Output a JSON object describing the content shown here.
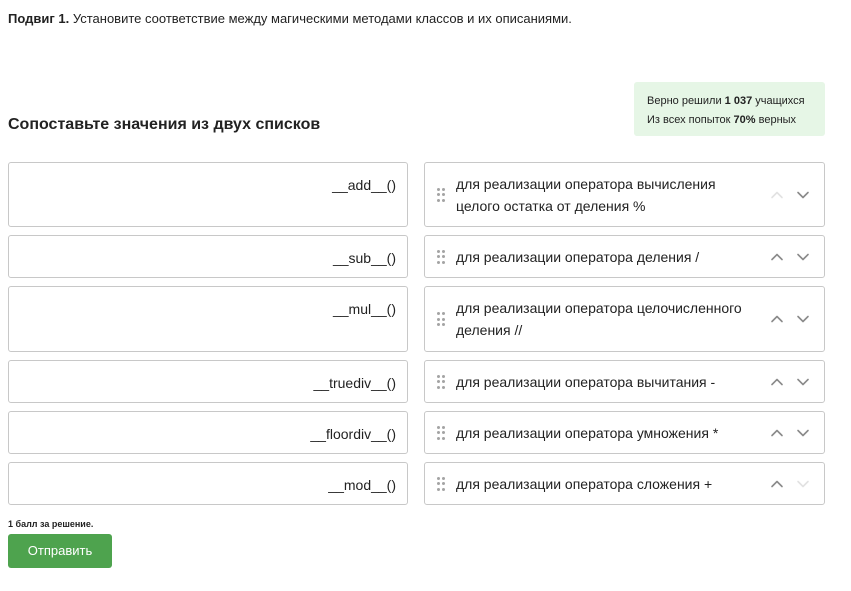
{
  "task": {
    "label": "Подвиг 1.",
    "text": "Установите соответствие между магическими методами классов и их описаниями."
  },
  "stats": {
    "solved_prefix": "Верно решили",
    "solved_count": "1 037",
    "solved_suffix": "учащихся",
    "attempts_prefix": "Из всех попыток",
    "attempts_percent": "70%",
    "attempts_suffix": "верных"
  },
  "heading": "Сопоставьте значения из двух списков",
  "pairs": [
    {
      "left": "__add__()",
      "right": "для реализации оператора вычисления целого остатка от деления %",
      "up_enabled": false,
      "down_enabled": true
    },
    {
      "left": "__sub__()",
      "right": "для реализации оператора деления /",
      "up_enabled": true,
      "down_enabled": true
    },
    {
      "left": "__mul__()",
      "right": "для реализации оператора целочисленного деления //",
      "up_enabled": true,
      "down_enabled": true
    },
    {
      "left": "__truediv__()",
      "right": "для реализации оператора вычитания -",
      "up_enabled": true,
      "down_enabled": true
    },
    {
      "left": "__floordiv__()",
      "right": "для реализации оператора умножения *",
      "up_enabled": true,
      "down_enabled": true
    },
    {
      "left": "__mod__()",
      "right": "для реализации оператора сложения +",
      "up_enabled": true,
      "down_enabled": false
    }
  ],
  "points_note": "1 балл за решение.",
  "submit_label": "Отправить",
  "colors": {
    "accent_green": "#4ea34e",
    "stats_bg": "#e6f6e6",
    "border": "#c8c8c8"
  },
  "icons": {
    "drag_handle": "drag-handle-icon",
    "move_up": "chevron-up-icon",
    "move_down": "chevron-down-icon"
  }
}
